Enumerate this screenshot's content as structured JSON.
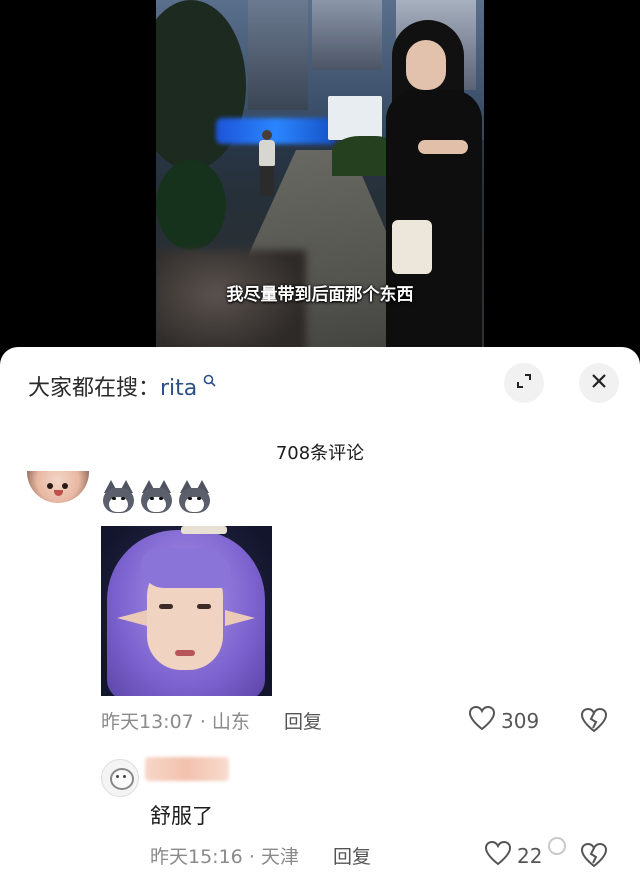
{
  "video": {
    "subtitle": "我尽量带到后面那个东西"
  },
  "sheet": {
    "search_prefix": "大家都在搜：",
    "search_keyword": "rita",
    "comment_count": "708条评论"
  },
  "comments": [
    {
      "time": "昨天13:07",
      "separator": "·",
      "location": "山东",
      "reply_label": "回复",
      "likes": "309",
      "emoji_count": 3,
      "emoji_icon": "husky-dog-sticker",
      "has_image": true
    }
  ],
  "replies": [
    {
      "text": "舒服了",
      "time": "昨天15:16",
      "separator": "·",
      "location": "天津",
      "reply_label": "回复",
      "likes": "22"
    }
  ],
  "icons": {
    "expand": "expand-icon",
    "close": "close-icon",
    "like": "heart-outline-icon",
    "dislike": "broken-heart-icon",
    "search": "search-icon"
  },
  "colors": {
    "keyword": "#2c4f86",
    "meta_gray": "#8a8a8a",
    "button_bg": "#f1f1f1"
  }
}
